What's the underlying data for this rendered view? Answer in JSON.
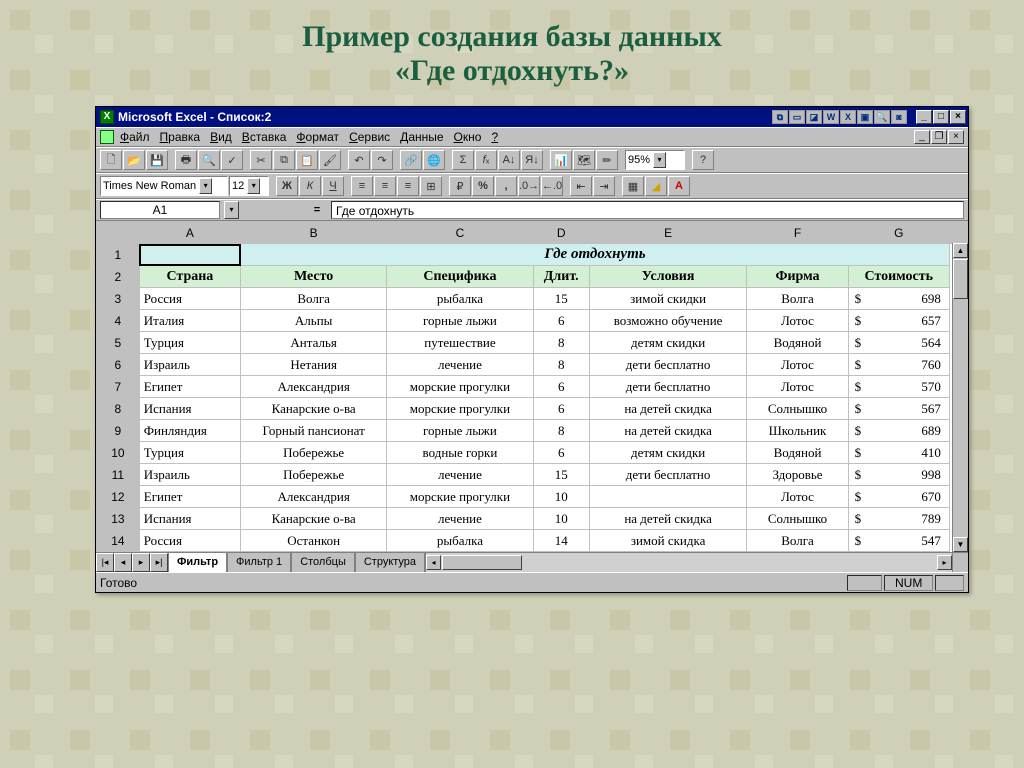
{
  "page": {
    "heading_line1": "Пример создания базы данных",
    "heading_line2": "«Где отдохнуть?»"
  },
  "titlebar": {
    "text": "Microsoft Excel - Список:2"
  },
  "menu": {
    "items": [
      "Файл",
      "Правка",
      "Вид",
      "Вставка",
      "Формат",
      "Сервис",
      "Данные",
      "Окно",
      "?"
    ]
  },
  "toolbar": {
    "zoom": "95%"
  },
  "format_bar": {
    "font_name": "Times New Roman",
    "font_size": "12"
  },
  "formula_bar": {
    "cell_ref": "A1",
    "value": "Где отдохнуть"
  },
  "columns": [
    "A",
    "B",
    "C",
    "D",
    "E",
    "F",
    "G"
  ],
  "table": {
    "title": "Где отдохнуть",
    "headers": [
      "Страна",
      "Место",
      "Специфика",
      "Длит.",
      "Условия",
      "Фирма",
      "Стоимость"
    ],
    "rows": [
      {
        "n": 3,
        "country": "Россия",
        "place": "Волга",
        "spec": "рыбалка",
        "dur": "15",
        "cond": "зимой скидки",
        "firm": "Волга",
        "cost": "698"
      },
      {
        "n": 4,
        "country": "Италия",
        "place": "Альпы",
        "spec": "горные лыжи",
        "dur": "6",
        "cond": "возможно обучение",
        "firm": "Лотос",
        "cost": "657"
      },
      {
        "n": 5,
        "country": "Турция",
        "place": "Анталья",
        "spec": "путешествие",
        "dur": "8",
        "cond": "детям скидки",
        "firm": "Водяной",
        "cost": "564"
      },
      {
        "n": 6,
        "country": "Израиль",
        "place": "Нетания",
        "spec": "лечение",
        "dur": "8",
        "cond": "дети бесплатно",
        "firm": "Лотос",
        "cost": "760"
      },
      {
        "n": 7,
        "country": "Египет",
        "place": "Александрия",
        "spec": "морские прогулки",
        "dur": "6",
        "cond": "дети бесплатно",
        "firm": "Лотос",
        "cost": "570"
      },
      {
        "n": 8,
        "country": "Испания",
        "place": "Канарские о-ва",
        "spec": "морские прогулки",
        "dur": "6",
        "cond": "на детей скидка",
        "firm": "Солнышко",
        "cost": "567"
      },
      {
        "n": 9,
        "country": "Финляндия",
        "place": "Горный пансионат",
        "spec": "горные лыжи",
        "dur": "8",
        "cond": "на детей скидка",
        "firm": "Школьник",
        "cost": "689"
      },
      {
        "n": 10,
        "country": "Турция",
        "place": "Побережье",
        "spec": "водные горки",
        "dur": "6",
        "cond": "детям скидки",
        "firm": "Водяной",
        "cost": "410"
      },
      {
        "n": 11,
        "country": "Израиль",
        "place": "Побережье",
        "spec": "лечение",
        "dur": "15",
        "cond": "дети бесплатно",
        "firm": "Здоровье",
        "cost": "998"
      },
      {
        "n": 12,
        "country": "Египет",
        "place": "Александрия",
        "spec": "морские прогулки",
        "dur": "10",
        "cond": "",
        "firm": "Лотос",
        "cost": "670"
      },
      {
        "n": 13,
        "country": "Испания",
        "place": "Канарские о-ва",
        "spec": "лечение",
        "dur": "10",
        "cond": "на детей скидка",
        "firm": "Солнышко",
        "cost": "789"
      },
      {
        "n": 14,
        "country": "Россия",
        "place": "Останкон",
        "spec": "рыбалка",
        "dur": "14",
        "cond": "зимой скидка",
        "firm": "Волга",
        "cost": "547"
      }
    ]
  },
  "tabs": {
    "items": [
      "Фильтр",
      "Фильтр 1",
      "Столбцы",
      "Структура"
    ],
    "active_index": 0
  },
  "status": {
    "ready": "Готово",
    "num": "NUM"
  }
}
